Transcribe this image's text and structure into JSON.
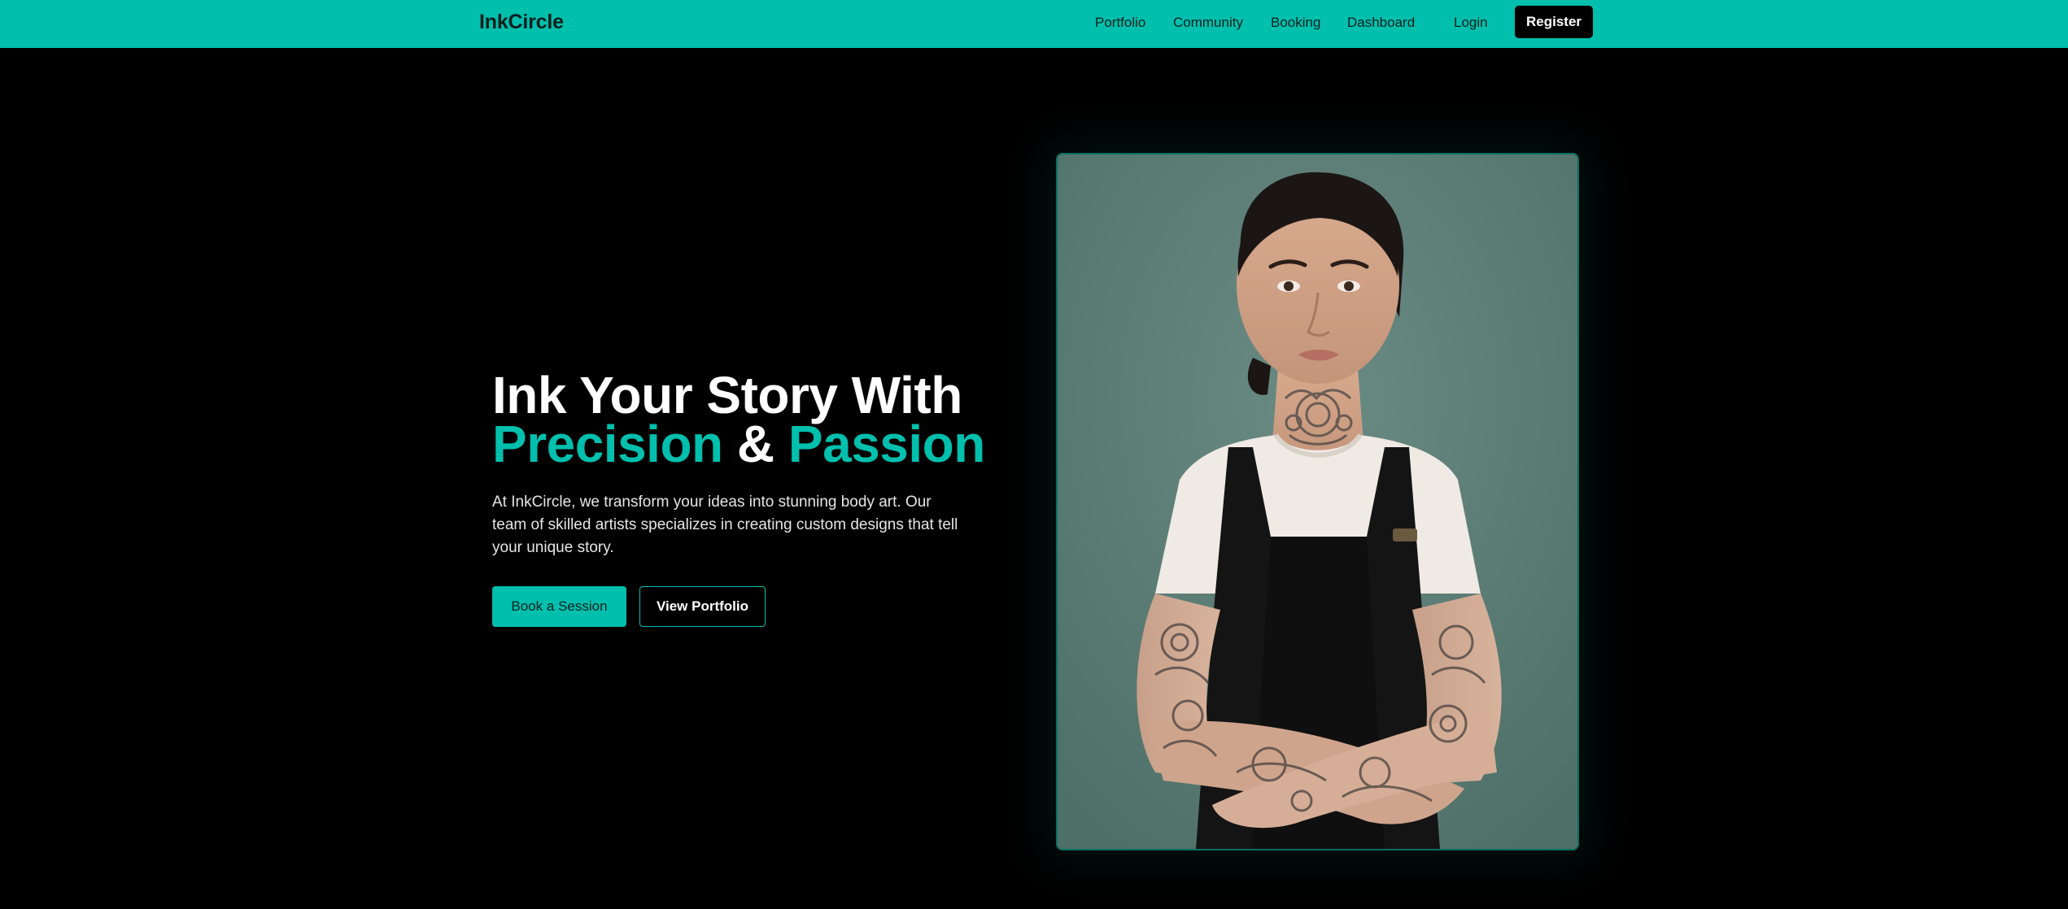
{
  "nav": {
    "brand": "InkCircle",
    "links": [
      "Portfolio",
      "Community",
      "Booking",
      "Dashboard"
    ],
    "login": "Login",
    "register": "Register"
  },
  "hero": {
    "title_line1": "Ink Your Story With",
    "title_word1": "Precision",
    "title_amp": " & ",
    "title_word2": "Passion",
    "description": "At InkCircle, we transform your ideas into stunning body art. Our team of skilled artists specializes in creating custom designs that tell your unique story.",
    "primary_button": "Book a Session",
    "secondary_button": "View Portfolio"
  },
  "colors": {
    "accent": "#00bfad",
    "background": "#000000",
    "photo_background": "#5c7f78"
  }
}
